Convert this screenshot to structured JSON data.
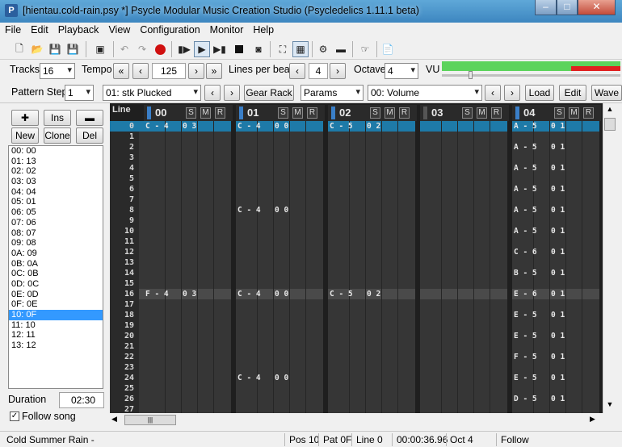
{
  "window": {
    "title": "[hientau.cold-rain.psy *] Psycle Modular Music Creation Studio (Psycledelics 1.11.1 beta)"
  },
  "menu": [
    "File",
    "Edit",
    "Playback",
    "View",
    "Configuration",
    "Monitor",
    "Help"
  ],
  "toolbar2": {
    "tracks_label": "Tracks",
    "tracks_value": "16",
    "tempo_label": "Tempo",
    "tempo_value": "125",
    "lpb_label": "Lines per beat",
    "lpb_value": "4",
    "octave_label": "Octave",
    "octave_value": "4",
    "vu_label": "VU"
  },
  "toolbar3": {
    "pattern_step_label": "Pattern Step",
    "pattern_step_value": "1",
    "machine": "01: stk Plucked",
    "gear_rack": "Gear Rack",
    "params": "Params",
    "param_value": "00: Volume",
    "load": "Load",
    "edit": "Edit",
    "wave": "Wave"
  },
  "seq_buttons": {
    "ins": "Ins",
    "new": "New",
    "clone": "Clone",
    "del": "Del"
  },
  "sequence": [
    "00: 00",
    "01: 13",
    "02: 02",
    "03: 03",
    "04: 04",
    "05: 01",
    "06: 05",
    "07: 06",
    "08: 07",
    "09: 08",
    "0A: 09",
    "0B: 0A",
    "0C: 0B",
    "0D: 0C",
    "0E: 0D",
    "0F: 0E",
    "10: 0F",
    "11: 10",
    "12: 11",
    "13: 12"
  ],
  "sequence_selected": 16,
  "duration_label": "Duration",
  "duration_value": "02:30",
  "follow_song_label": "Follow song",
  "pattern": {
    "line_header": "Line",
    "tracks": [
      "00",
      "01",
      "02",
      "03",
      "04"
    ],
    "smr": [
      "S",
      "M",
      "R"
    ],
    "lines": [
      "0",
      "1",
      "2",
      "3",
      "4",
      "5",
      "6",
      "7",
      "8",
      "9",
      "10",
      "11",
      "12",
      "13",
      "14",
      "15",
      "16",
      "17",
      "18",
      "19",
      "20",
      "21",
      "22",
      "23",
      "24",
      "25",
      "26",
      "27"
    ],
    "notes": [
      {
        "line": 0,
        "track": 0,
        "note": "C - 4",
        "vel": "0 3"
      },
      {
        "line": 0,
        "track": 1,
        "note": "C - 4",
        "vel": "0 0"
      },
      {
        "line": 0,
        "track": 2,
        "note": "C - 5",
        "vel": "0 2"
      },
      {
        "line": 0,
        "track": 4,
        "note": "A - 5",
        "vel": "0 1"
      },
      {
        "line": 2,
        "track": 4,
        "note": "A - 5",
        "vel": "0 1"
      },
      {
        "line": 4,
        "track": 4,
        "note": "A - 5",
        "vel": "0 1"
      },
      {
        "line": 6,
        "track": 4,
        "note": "A - 5",
        "vel": "0 1"
      },
      {
        "line": 8,
        "track": 1,
        "note": "C - 4",
        "vel": "0 0"
      },
      {
        "line": 8,
        "track": 4,
        "note": "A - 5",
        "vel": "0 1"
      },
      {
        "line": 10,
        "track": 4,
        "note": "A - 5",
        "vel": "0 1"
      },
      {
        "line": 12,
        "track": 4,
        "note": "C - 6",
        "vel": "0 1"
      },
      {
        "line": 14,
        "track": 4,
        "note": "B - 5",
        "vel": "0 1"
      },
      {
        "line": 16,
        "track": 0,
        "note": "F - 4",
        "vel": "0 3"
      },
      {
        "line": 16,
        "track": 1,
        "note": "C - 4",
        "vel": "0 0"
      },
      {
        "line": 16,
        "track": 2,
        "note": "C - 5",
        "vel": "0 2"
      },
      {
        "line": 16,
        "track": 4,
        "note": "E - 6",
        "vel": "0 1"
      },
      {
        "line": 18,
        "track": 4,
        "note": "E - 5",
        "vel": "0 1"
      },
      {
        "line": 20,
        "track": 4,
        "note": "E - 5",
        "vel": "0 1"
      },
      {
        "line": 22,
        "track": 4,
        "note": "F - 5",
        "vel": "0 1"
      },
      {
        "line": 24,
        "track": 1,
        "note": "C - 4",
        "vel": "0 0"
      },
      {
        "line": 24,
        "track": 4,
        "note": "E - 5",
        "vel": "0 1"
      },
      {
        "line": 26,
        "track": 4,
        "note": "D - 5",
        "vel": "0 1"
      }
    ]
  },
  "status": {
    "song": "Cold Summer Rain -",
    "pos": "Pos 10",
    "pat": "Pat 0F",
    "line": "Line 0",
    "time": "00:00:36.96",
    "oct": "Oct 4",
    "follow": "Follow"
  },
  "colors": {
    "selected_row": "#1e7aa8",
    "beat_row": "#4a4a4a",
    "track_bar": "#3a7fc8"
  }
}
